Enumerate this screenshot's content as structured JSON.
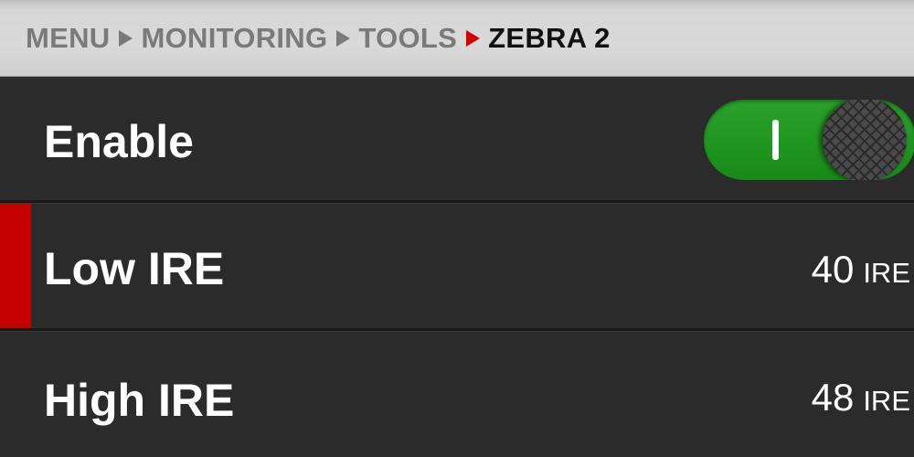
{
  "breadcrumb": {
    "items": [
      "MENU",
      "MONITORING",
      "TOOLS",
      "ZEBRA 2"
    ]
  },
  "rows": {
    "enable": {
      "label": "Enable",
      "toggle_on": true
    },
    "low_ire": {
      "label": "Low IRE",
      "value": "40",
      "unit": "IRE",
      "selected": true
    },
    "high_ire": {
      "label": "High IRE",
      "value": "48",
      "unit": "IRE"
    }
  },
  "colors": {
    "accent": "#c40000",
    "toggle_on": "#1f961f"
  }
}
